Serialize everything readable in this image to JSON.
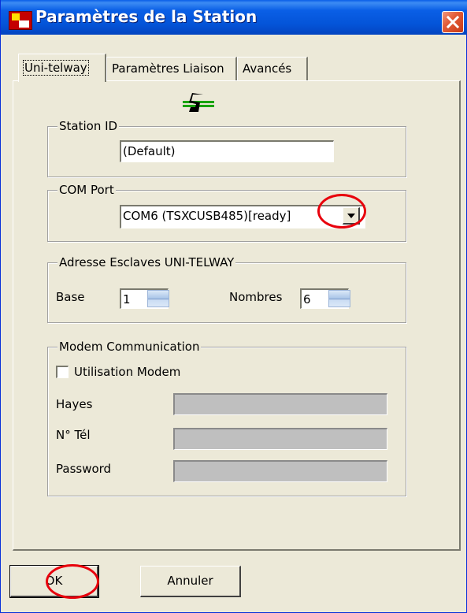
{
  "window": {
    "title": "Paramètres de la Station"
  },
  "tabs": [
    {
      "label": "Uni-telway",
      "active": true
    },
    {
      "label": "Paramètres Liaison",
      "active": false
    },
    {
      "label": "Avancés",
      "active": false
    }
  ],
  "station_id": {
    "group_label": "Station ID",
    "value": "(Default)"
  },
  "com_port": {
    "group_label": "COM Port",
    "selected": "COM6 (TSXCUSB485)[ready]"
  },
  "slave_address": {
    "group_label": "Adresse Esclaves UNI-TELWAY",
    "base_label": "Base",
    "base_value": "1",
    "count_label": "Nombres",
    "count_value": "6"
  },
  "modem": {
    "group_label": "Modem Communication",
    "use_modem_label": "Utilisation Modem",
    "use_modem_checked": false,
    "hayes_label": "Hayes",
    "hayes_value": "",
    "phone_label": "N° Tél",
    "phone_value": "",
    "password_label": "Password",
    "password_value": ""
  },
  "buttons": {
    "ok": "OK",
    "cancel": "Annuler"
  },
  "colors": {
    "titlebar": "#0454d8",
    "dialog_bg": "#ece9d8",
    "highlight_circle": "#e8000c",
    "logo_green": "#19a30f"
  },
  "icons": {
    "app": "station-app-icon",
    "close": "close-icon",
    "logo": "unitelway-logo-icon",
    "dropdown": "chevron-down-icon"
  }
}
